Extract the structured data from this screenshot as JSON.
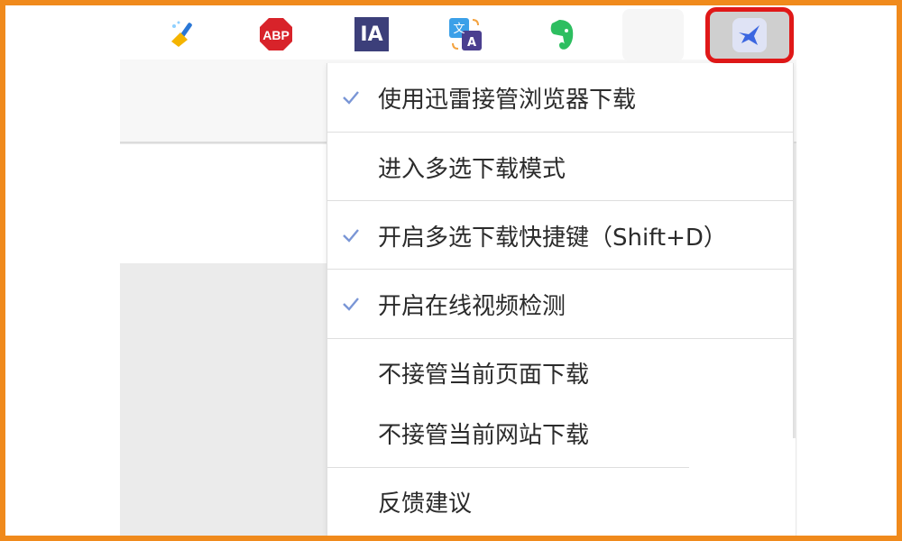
{
  "toolbar": {
    "extensions": [
      {
        "name": "broom-icon"
      },
      {
        "name": "adblock-plus-icon",
        "label": "ABP"
      },
      {
        "name": "ia-icon",
        "label": "IA"
      },
      {
        "name": "translate-icon",
        "text_top": "文",
        "text_bottom": "A"
      },
      {
        "name": "evernote-icon"
      },
      {
        "name": "blank-extension-slot"
      },
      {
        "name": "thunder-bird-icon",
        "highlighted": true
      }
    ],
    "accent_color": "#e01818"
  },
  "menu": {
    "items": [
      {
        "label": "使用迅雷接管浏览器下载",
        "checked": true
      },
      {
        "label": "进入多选下载模式",
        "checked": false
      },
      {
        "label": "开启多选下载快捷键（Shift+D）",
        "checked": true
      },
      {
        "label": "开启在线视频检测",
        "checked": true
      },
      {
        "label": "不接管当前页面下载",
        "checked": false
      },
      {
        "label": "不接管当前网站下载",
        "checked": false
      },
      {
        "label": "反馈建议",
        "checked": false
      }
    ],
    "check_color": "#7a96d6"
  }
}
